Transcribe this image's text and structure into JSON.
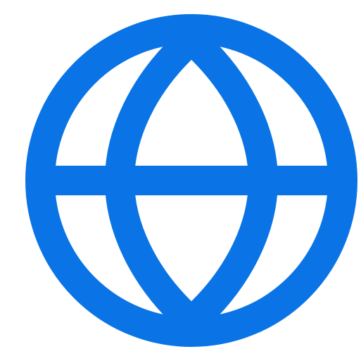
{
  "icon": {
    "name": "globe-icon",
    "stroke_color": "#0A74E6",
    "background_color": "#FFFFFF"
  }
}
